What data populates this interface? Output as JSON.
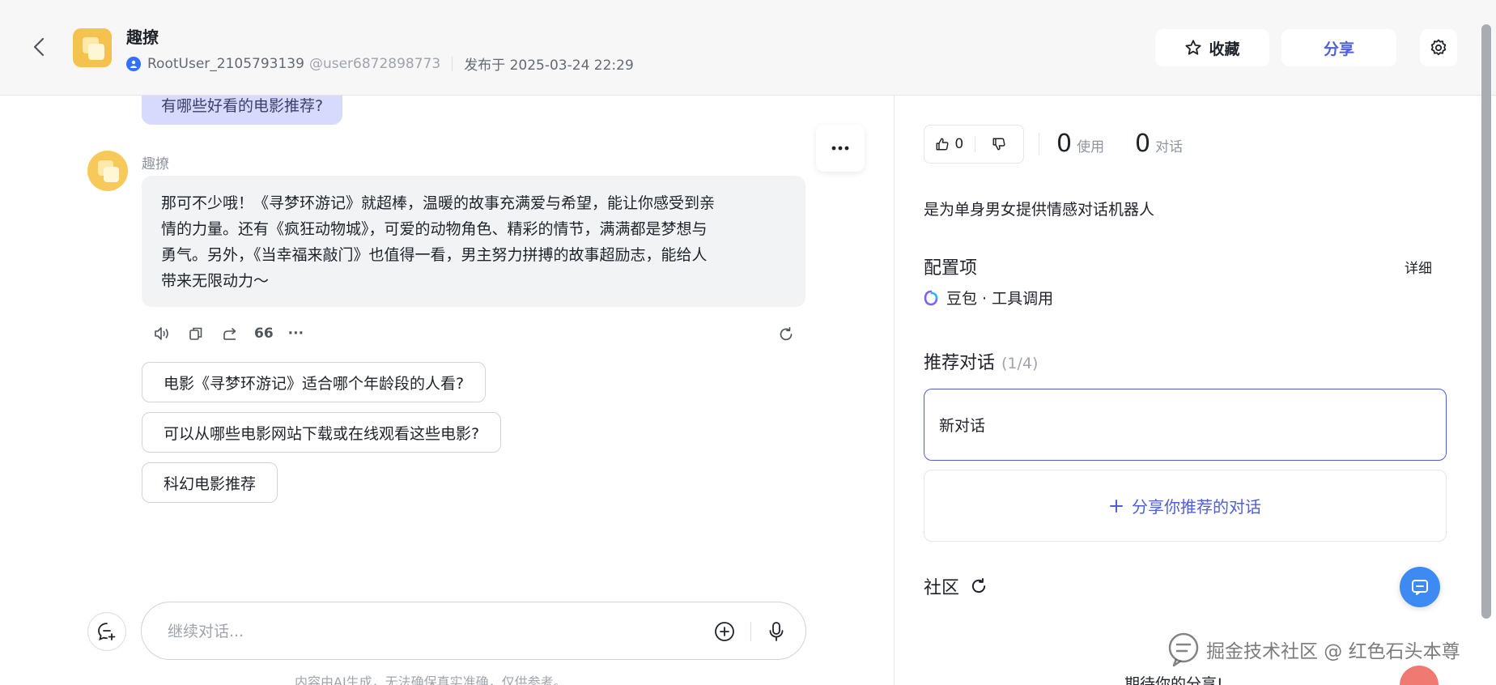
{
  "header": {
    "bot_name": "趣撩",
    "username": "RootUser_2105793139",
    "handle": "@user6872898773",
    "published": "发布于 2025-03-24 22:29",
    "favorite_label": "收藏",
    "share_label": "分享"
  },
  "chat": {
    "user_message": "有哪些好看的电影推荐?",
    "reply_name": "趣撩",
    "reply_lines": [
      "那可不少哦！《寻梦环游记》就超棒，温暖的故事充满爱与希望，能让你感受到亲",
      "情的力量。还有《疯狂动物城》，可爱的动物角色、精彩的情节，满满都是梦想与",
      "勇气。另外，《当幸福来敲门》也值得一看，男主努力拼搏的故事超励志，能给人",
      "带来无限动力～"
    ],
    "quote_label": "66",
    "more_label": "···",
    "suggestions": [
      "电影《寻梦环游记》适合哪个年龄段的人看?",
      "可以从哪些电影网站下载或在线观看这些电影?",
      "科幻电影推荐"
    ],
    "input_placeholder": "继续对话...",
    "disclaimer": "内容由AI生成，无法确保真实准确，仅供参考。"
  },
  "panel": {
    "likes": "0",
    "uses": "0",
    "uses_label": "使用",
    "dialogs": "0",
    "dialogs_label": "对话",
    "description": "是为单身男女提供情感对话机器人",
    "config_title": "配置项",
    "detail_label": "详细",
    "model": "豆包 · 工具调用",
    "recommend_title": "推荐对话",
    "recommend_count": "(1/4)",
    "new_dialog": "新对话",
    "share_recommend": "分享你推荐的对话",
    "community_title": "社区",
    "bottom_text": "期待你的分享!"
  },
  "watermark": "掘金技术社区 @ 红色石头本尊",
  "colors": {
    "accent": "#4e5fd9",
    "user_bubble": "#d7dafd",
    "fab": "#3d8bf2"
  }
}
